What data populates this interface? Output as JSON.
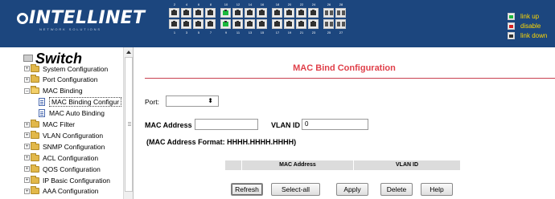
{
  "header": {
    "logo_text": "INTELLINET",
    "logo_subtitle": "NETWORK SOLUTIONS",
    "port_top_numbers": [
      "2",
      "4",
      "6",
      "8",
      "10",
      "12",
      "14",
      "16",
      "18",
      "20",
      "22",
      "24",
      "26",
      "28"
    ],
    "port_bottom_numbers": [
      "1",
      "3",
      "5",
      "7",
      "9",
      "11",
      "13",
      "15",
      "17",
      "19",
      "21",
      "23",
      "25",
      "27"
    ],
    "legend": [
      {
        "label": "link up",
        "status": "up",
        "color": "#1bb83c"
      },
      {
        "label": "disable",
        "status": "disable",
        "color": "#d62020"
      },
      {
        "label": "link down",
        "status": "down",
        "color": "#303030"
      }
    ],
    "link_up_ports": [
      9,
      10
    ]
  },
  "sidebar": {
    "title": "Switch",
    "items": [
      {
        "label": "System Configuration",
        "type": "folder",
        "expander": "+"
      },
      {
        "label": "Port Configuration",
        "type": "folder",
        "expander": "+"
      },
      {
        "label": "MAC Binding",
        "type": "folder-open",
        "expander": "−"
      },
      {
        "label": "MAC Binding Configur",
        "type": "page",
        "selected": true
      },
      {
        "label": "MAC Auto Binding",
        "type": "page"
      },
      {
        "label": "MAC Filter",
        "type": "folder",
        "expander": "+"
      },
      {
        "label": "VLAN Configuration",
        "type": "folder",
        "expander": "+"
      },
      {
        "label": "SNMP Configuration",
        "type": "folder",
        "expander": "+"
      },
      {
        "label": "ACL Configuration",
        "type": "folder",
        "expander": "+"
      },
      {
        "label": "QOS Configuration",
        "type": "folder",
        "expander": "+"
      },
      {
        "label": "IP Basic Configuration",
        "type": "folder",
        "expander": "+"
      },
      {
        "label": "AAA Configuration",
        "type": "folder",
        "expander": "+"
      }
    ]
  },
  "main": {
    "title": "MAC Bind Configuration",
    "port_label": "Port:",
    "port_value": "",
    "mac_address_label": "MAC Address",
    "mac_address_value": "",
    "vlan_id_label": "VLAN ID",
    "vlan_id_value": "0",
    "format_note": "(MAC Address Format: HHHH.HHHH.HHHH)",
    "table_columns": [
      "",
      "MAC Address",
      "VLAN ID"
    ],
    "buttons": {
      "refresh": "Refresh",
      "select_all": "Select-all",
      "apply": "Apply",
      "delete": "Delete",
      "help": "Help"
    }
  }
}
